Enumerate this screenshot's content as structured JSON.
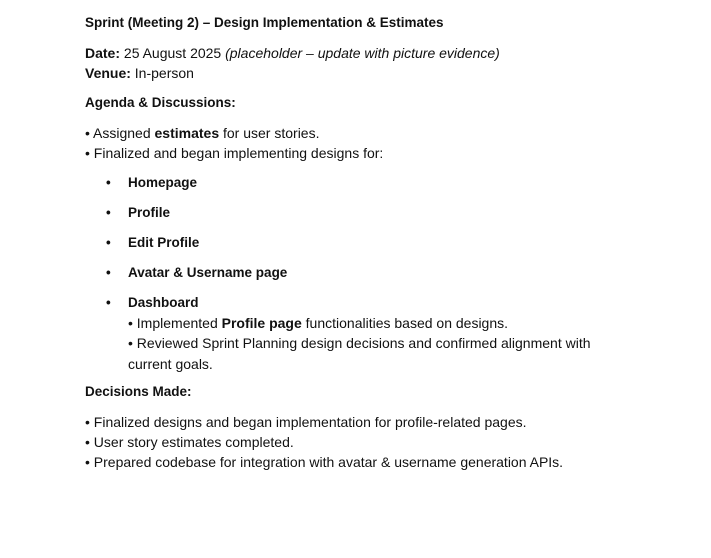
{
  "document": {
    "title": "Sprint (Meeting 2) – Design Implementation & Estimates",
    "date_label": "Date:",
    "date_value": "25 August 2025",
    "date_note": "(placeholder – update with picture evidence)",
    "venue_label": "Venue:",
    "venue_value": "In-person",
    "agenda_heading": "Agenda & Discussions:",
    "agenda_items": [
      {
        "bullet": "•",
        "prefix": "Assigned ",
        "bold": "estimates",
        "suffix": " for user stories."
      },
      {
        "bullet": "•",
        "text": "Finalized and began implementing designs for:"
      }
    ],
    "design_pages": [
      "Homepage",
      "Profile",
      "Edit Profile",
      "Avatar & Username page",
      "Dashboard"
    ],
    "sub_bullet": "•",
    "dashboard_notes": [
      {
        "bullet": "•",
        "prefix": "Implemented ",
        "bold": "Profile page",
        "suffix": " functionalities based on designs."
      },
      {
        "bullet": "•",
        "text": "Reviewed Sprint Planning design decisions and confirmed alignment with current goals."
      }
    ],
    "decisions_heading": "Decisions Made:",
    "decisions": [
      "• Finalized designs and began implementation for profile-related pages.",
      "• User story estimates completed.",
      "• Prepared codebase for integration with avatar & username generation APIs."
    ]
  }
}
